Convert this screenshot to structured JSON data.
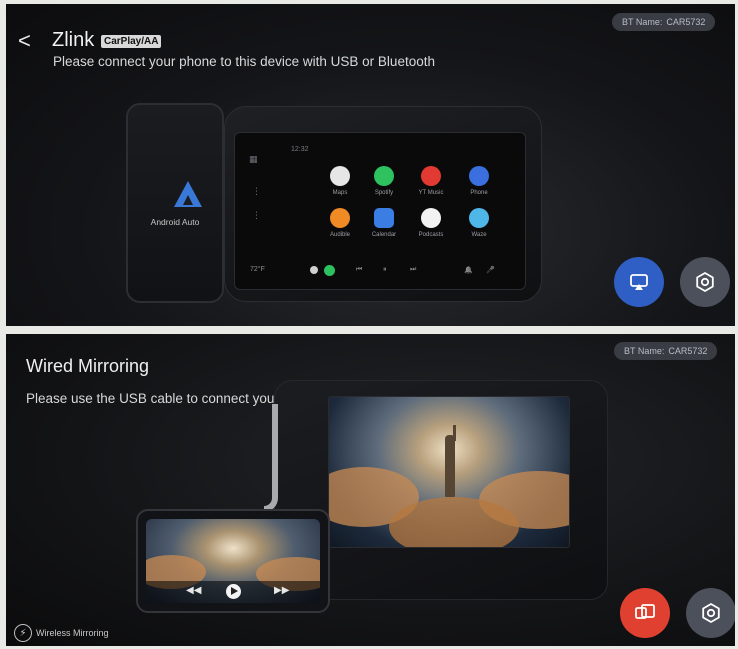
{
  "top": {
    "back_glyph": "<",
    "app_title": "Zlink",
    "badge": "CarPlay/AA",
    "subtitle": "Please connect your phone to this device with USB or Bluetooth",
    "bt": {
      "key": "BT Name:",
      "value": "CAR5732"
    },
    "phone_label": "Android Auto",
    "clock": "12:32",
    "apps": [
      {
        "label": "Maps",
        "color": "#e6e6e6"
      },
      {
        "label": "Spotify",
        "color": "#2ec15f"
      },
      {
        "label": "YT Music",
        "color": "#e23a33"
      },
      {
        "label": "Phone",
        "color": "#3b6fe0"
      },
      {
        "label": "Audible",
        "color": "#f08a24"
      },
      {
        "label": "Calendar",
        "color": "#3a7de3"
      },
      {
        "label": "Podcasts",
        "color": "#f2f2f2"
      },
      {
        "label": "Waze",
        "color": "#4fb6e8"
      }
    ],
    "bar": {
      "temp": "72°F",
      "prev": "⏮",
      "pause": "⏸",
      "next": "⏭",
      "bell": "🔔",
      "mic": "🎤"
    },
    "fab_cast_color": "#2f5fc4",
    "fab_settings_color": "#4c505b"
  },
  "bottom": {
    "title": "Wired Mirroring",
    "subtitle": "Please use the USB cable to connect your phone and Bluetooth",
    "bt": {
      "key": "BT Name:",
      "value": "CAR5732"
    },
    "controls": {
      "rewind": "◀◀",
      "forward": "▶▶"
    },
    "wireless_label": "Wireless Mirroring",
    "fab_mirror_color": "#e0402f",
    "fab_settings_color": "#4c505b"
  }
}
